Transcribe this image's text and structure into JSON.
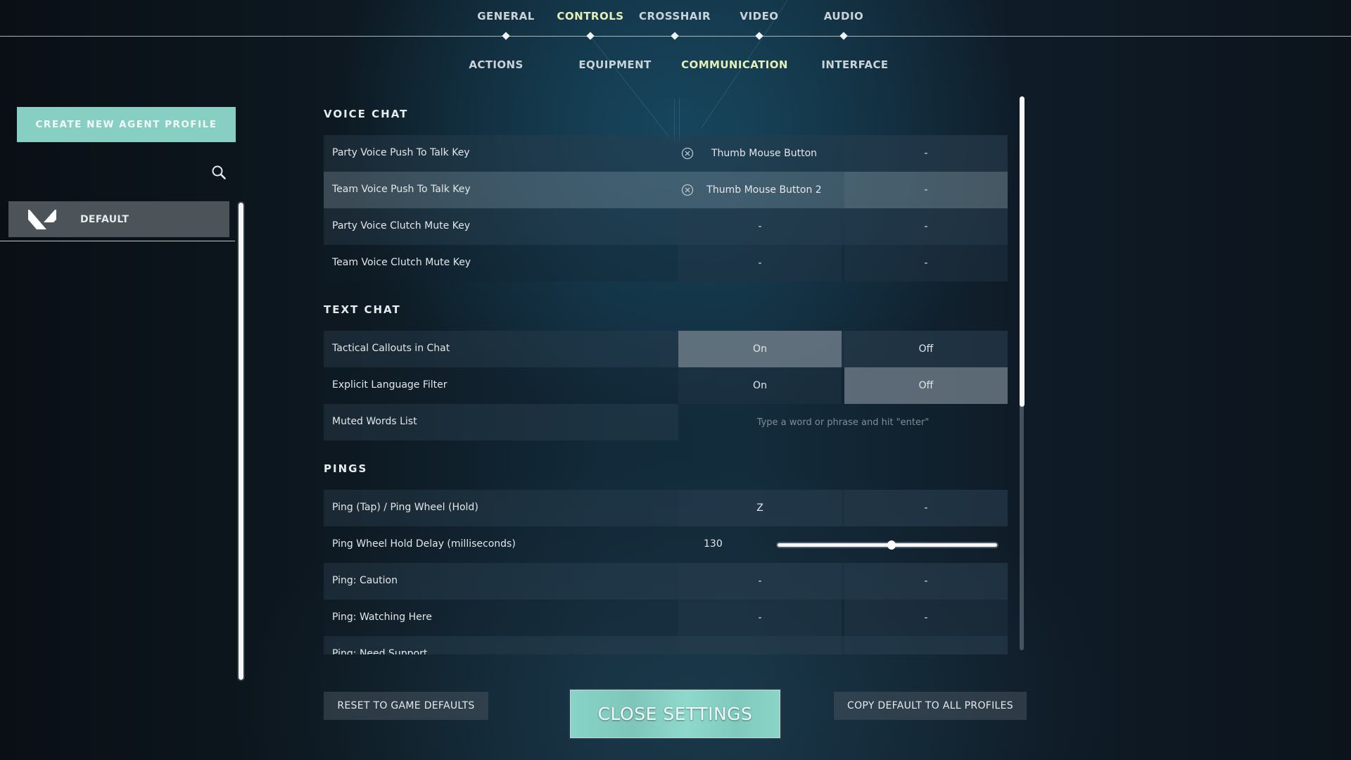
{
  "top_tabs": [
    {
      "label": "GENERAL",
      "active": false
    },
    {
      "label": "CONTROLS",
      "active": true
    },
    {
      "label": "CROSSHAIR",
      "active": false
    },
    {
      "label": "VIDEO",
      "active": false
    },
    {
      "label": "AUDIO",
      "active": false
    }
  ],
  "sub_tabs": [
    {
      "label": "ACTIONS",
      "active": false
    },
    {
      "label": "EQUIPMENT",
      "active": false
    },
    {
      "label": "COMMUNICATION",
      "active": true
    },
    {
      "label": "INTERFACE",
      "active": false
    }
  ],
  "sidebar": {
    "create_button": "CREATE NEW AGENT PROFILE",
    "search_icon": "search-icon",
    "profiles": [
      {
        "label": "DEFAULT",
        "icon": "valorant-logo-icon",
        "selected": true
      }
    ]
  },
  "sections": {
    "voice_chat": {
      "title": "VOICE CHAT",
      "rows": [
        {
          "label": "Party Voice Push To Talk Key",
          "primary": "Thumb Mouse Button",
          "secondary": "-",
          "clearable": true
        },
        {
          "label": "Team Voice Push To Talk Key",
          "primary": "Thumb Mouse Button 2",
          "secondary": "-",
          "clearable": true,
          "highlighted": true
        },
        {
          "label": "Party Voice Clutch Mute Key",
          "primary": "-",
          "secondary": "-"
        },
        {
          "label": "Team Voice Clutch Mute Key",
          "primary": "-",
          "secondary": "-"
        }
      ]
    },
    "text_chat": {
      "title": "TEXT CHAT",
      "rows": [
        {
          "label": "Tactical Callouts in Chat",
          "on": "On",
          "off": "Off",
          "selected": "On"
        },
        {
          "label": "Explicit Language Filter",
          "on": "On",
          "off": "Off",
          "selected": "Off"
        },
        {
          "label": "Muted Words List",
          "value": "",
          "placeholder": "Type a word or phrase and hit \"enter\""
        }
      ]
    },
    "pings": {
      "title": "PINGS",
      "rows": [
        {
          "label": "Ping (Tap) / Ping Wheel (Hold)",
          "primary": "Z",
          "secondary": "-"
        },
        {
          "label": "Ping Wheel Hold Delay (milliseconds)",
          "value": "130",
          "slider_fraction": 0.52
        },
        {
          "label": "Ping: Caution",
          "primary": "-",
          "secondary": "-"
        },
        {
          "label": "Ping: Watching Here",
          "primary": "-",
          "secondary": "-"
        },
        {
          "label": "Ping: Need Support",
          "primary": "",
          "secondary": ""
        }
      ]
    }
  },
  "scroll": {
    "main_position_fraction": 0.0,
    "main_visible_fraction": 0.56
  },
  "footer": {
    "reset_button": "RESET TO GAME DEFAULTS",
    "close_button": "CLOSE SETTINGS",
    "copy_button": "COPY DEFAULT TO ALL PROFILES"
  },
  "colors": {
    "accent_teal": "#86cfc2",
    "active_tab": "#e5f0b6",
    "selected_cell": "#78878f"
  }
}
